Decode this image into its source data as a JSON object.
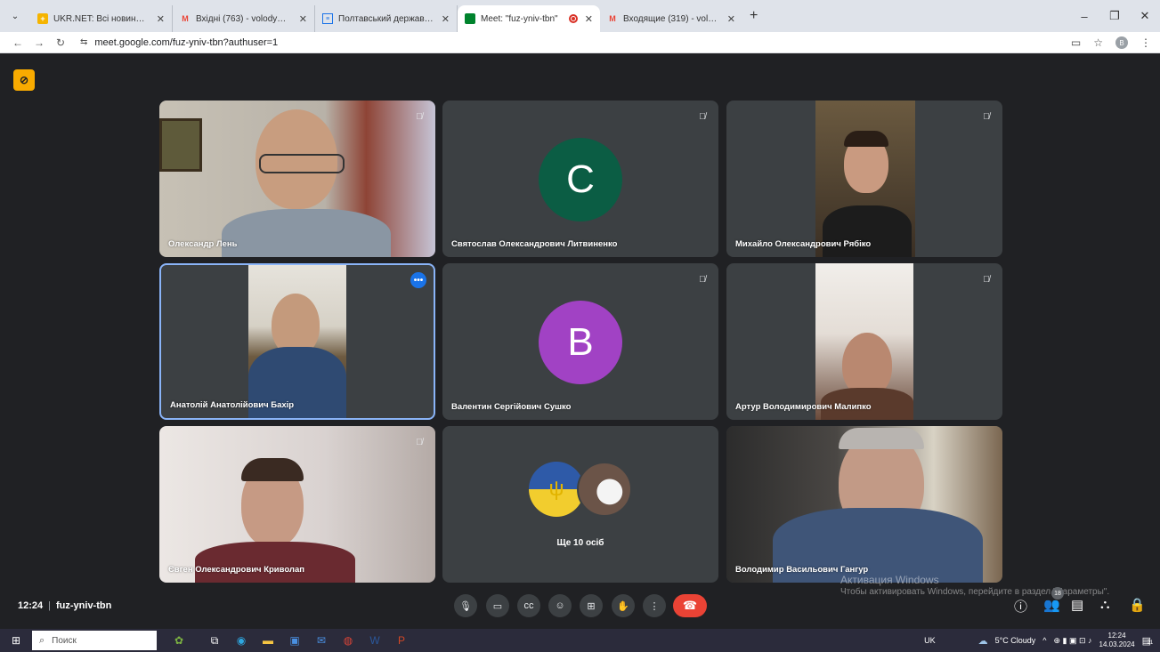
{
  "browser": {
    "tabs": [
      {
        "title": "UKR.NET: Всі новини України,",
        "favicon_color": "#f5b400",
        "active": false
      },
      {
        "title": "Вхідні (763) - volodymyr.hanhu",
        "favicon_color": "#ea4335",
        "active": false
      },
      {
        "title": "Полтавський державний агра",
        "favicon_color": "#1a73e8",
        "active": false
      },
      {
        "title": "Meet: \"fuz-yniv-tbn\"",
        "favicon_color": "#00832d",
        "active": true
      },
      {
        "title": "Входящие (319) - volodimirgar",
        "favicon_color": "#ea4335",
        "active": false
      }
    ],
    "url": "meet.google.com/fuz-yniv-tbn?authuser=1",
    "profile_initial": "B"
  },
  "tiles": [
    {
      "name": "Олександр Лень",
      "type": "video",
      "muted": true
    },
    {
      "name": "Святослав Олександрович Литвиненко",
      "type": "avatar",
      "initial": "C",
      "avatar_color": "#0b5d44",
      "muted": true
    },
    {
      "name": "Михайло Олександрович Рябіко",
      "type": "video",
      "muted": true
    },
    {
      "name": "Анатолій Анатолійович Бахір",
      "type": "video",
      "muted": false,
      "highlighted": true
    },
    {
      "name": "Валентин Сергійович Сушко",
      "type": "avatar",
      "initial": "B",
      "avatar_color": "#a142c4",
      "muted": true
    },
    {
      "name": "Артур Володимирович Малипко",
      "type": "video",
      "muted": true
    },
    {
      "name": "Євген Олександрович Криволап",
      "type": "video",
      "muted": true
    },
    {
      "name": "Ще 10 осіб",
      "type": "more"
    },
    {
      "name": "Володимир Васильович Гангур",
      "type": "video",
      "muted": false
    }
  ],
  "bottom_bar": {
    "time": "12:24",
    "separator": "|",
    "meeting_code": "fuz-yniv-tbn",
    "participants_count": "18"
  },
  "watermark": {
    "line1": "Активация Windows",
    "line2": "Чтобы активировать Windows, перейдите в раздел \"Параметры\"."
  },
  "taskbar": {
    "search_placeholder": "Поиск",
    "language": "UK",
    "weather": "5°C  Cloudy",
    "clock_time": "12:24",
    "clock_date": "14.03.2024",
    "notification_count": "21"
  }
}
